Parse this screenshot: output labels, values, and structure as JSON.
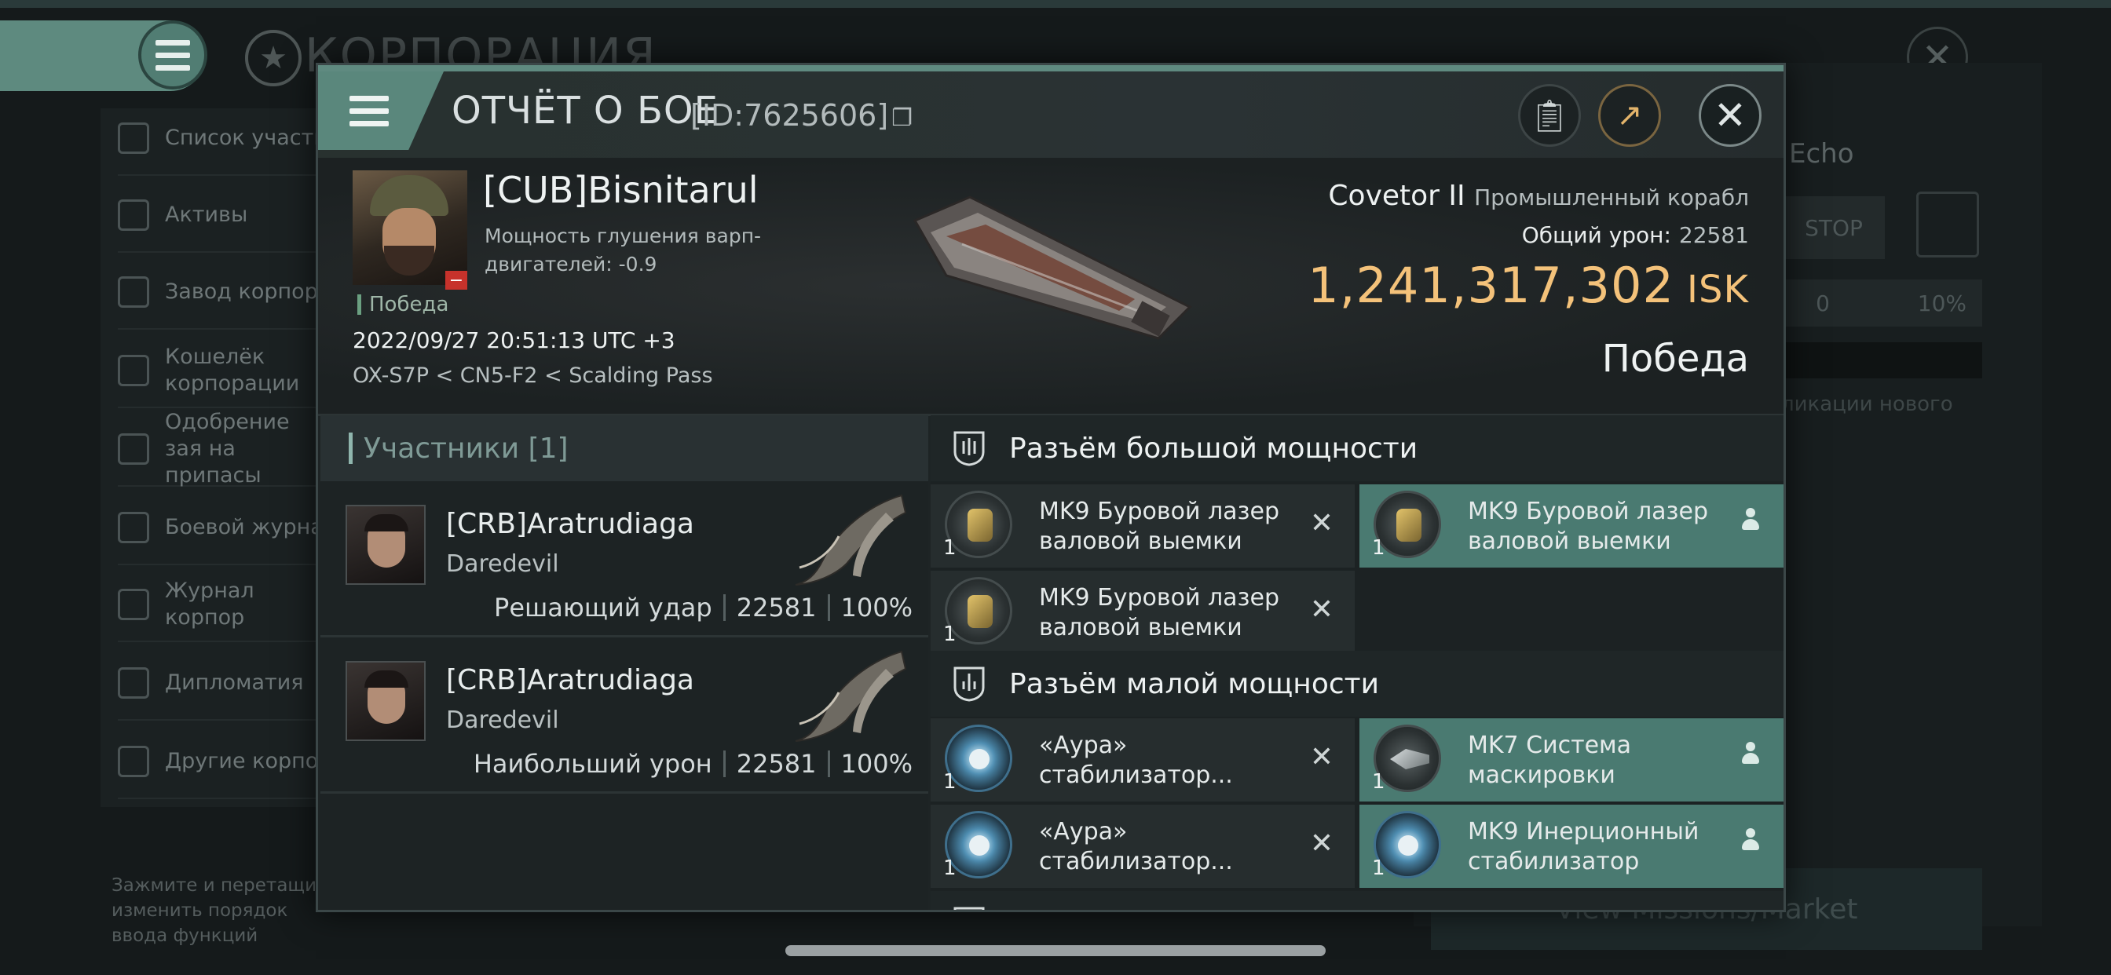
{
  "background": {
    "page_title": "КОРПОРАЦИЯ",
    "sidebar": [
      {
        "label": "Список участн",
        "icon": "members-icon"
      },
      {
        "label": "Активы",
        "icon": "assets-icon"
      },
      {
        "label": "Завод корпора",
        "icon": "factory-icon"
      },
      {
        "label": "Кошелёк корпорации",
        "icon": "wallet-icon"
      },
      {
        "label": "Одобрение зая на припасы",
        "icon": "approval-icon"
      },
      {
        "label": "Боевой журнал",
        "icon": "combat-log-icon"
      },
      {
        "label": "Журнал корпор",
        "icon": "journal-icon"
      },
      {
        "label": "Дипломатия",
        "icon": "diplomacy-icon"
      },
      {
        "label": "Другие корпор",
        "icon": "other-corps-icon"
      }
    ],
    "hint": "Зажмите и перетащите изменить порядок ввода функций",
    "right": {
      "echo": "Echo",
      "stop": "STOP",
      "num_left": "0",
      "num_right": "10%",
      "note": "ликации нового",
      "market_button": "View Missions/Market"
    }
  },
  "modal": {
    "title": "ОТЧЁТ О БОЕ",
    "id_text": "[ID:7625606]",
    "victim": {
      "pilot": "[CUB]Bisnitarul",
      "warp_label": "Мощность глушения варп-двигателей: -0.9",
      "status": "Победа",
      "datetime": "2022/09/27 20:51:13 UTC +3",
      "location": "OX-S7P < CN5-F2 < Scalding Pass"
    },
    "ship": {
      "name": "Covetor II",
      "class": "Промышленный корабл",
      "total_damage_label": "Общий урон:",
      "total_damage": "22581",
      "isk_value": "1,241,317,302",
      "isk_unit": "ISK",
      "result": "Победа"
    },
    "participants": {
      "header": "Участники [1]",
      "rows": [
        {
          "name": "[CRB]Aratrudiaga",
          "ship": "Daredevil",
          "role": "Решающий удар",
          "damage": "22581",
          "percent": "100%"
        },
        {
          "name": "[CRB]Aratrudiaga",
          "ship": "Daredevil",
          "role": "Наибольший урон",
          "damage": "22581",
          "percent": "100%"
        }
      ]
    },
    "slots": {
      "high": {
        "title": "Разъём большой мощности",
        "modules": [
          {
            "name": "MK9 Буровой лазер валовой выемки",
            "count": "1",
            "status": "destroyed"
          },
          {
            "name": "MK9 Буровой лазер валовой выемки",
            "count": "1",
            "status": "dropped"
          },
          {
            "name": "MK9 Буровой лазер валовой выемки",
            "count": "1",
            "status": "destroyed"
          }
        ]
      },
      "low": {
        "title": "Разъём малой мощности",
        "modules": [
          {
            "name": "«Аура» стабилизатор...",
            "count": "1",
            "status": "destroyed"
          },
          {
            "name": "MK7 Система маскировки",
            "count": "1",
            "status": "dropped"
          },
          {
            "name": "«Аура» стабилизатор...",
            "count": "1",
            "status": "destroyed"
          },
          {
            "name": "MK9 Инерционный стабилизатор",
            "count": "1",
            "status": "dropped"
          }
        ]
      }
    }
  }
}
